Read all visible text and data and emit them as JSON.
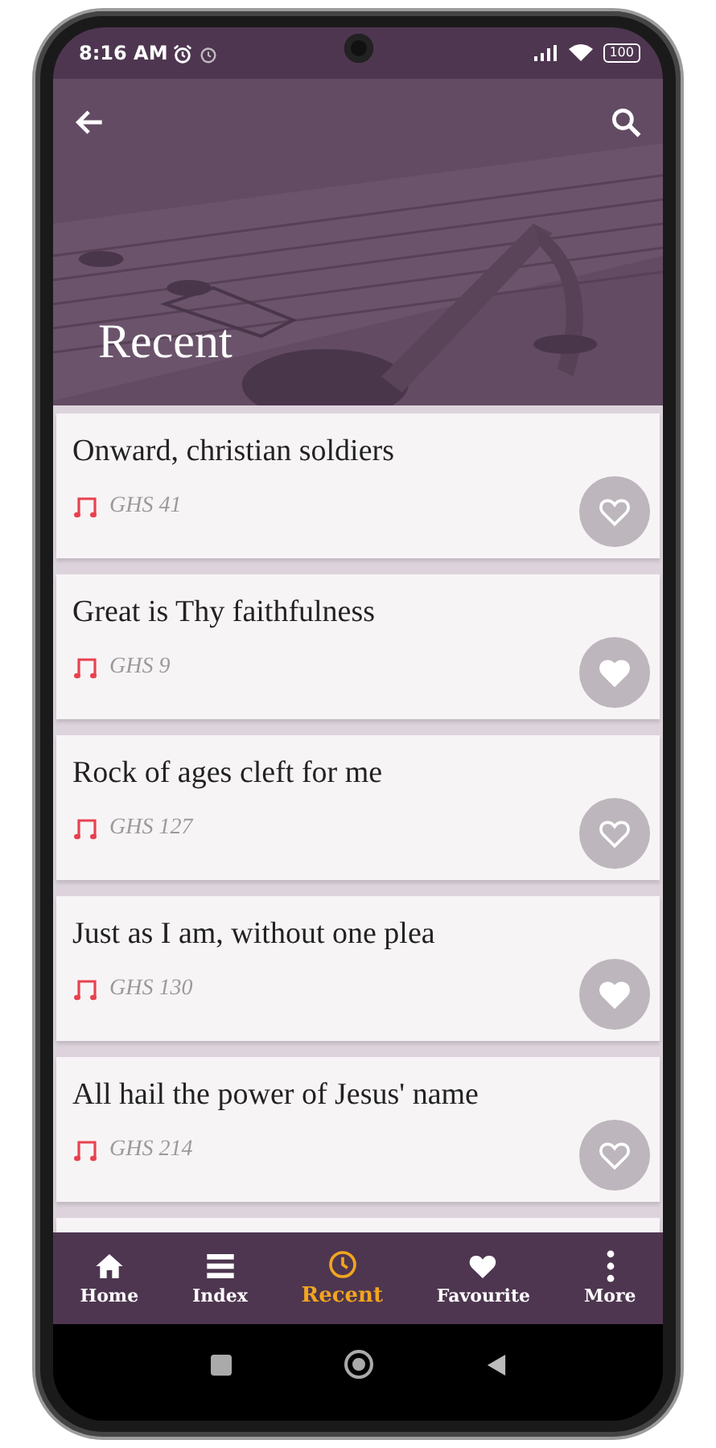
{
  "status_bar": {
    "time": "8:16 AM",
    "battery": "100"
  },
  "header": {
    "title": "Recent"
  },
  "hymns": [
    {
      "title": "Onward, christian soldiers",
      "number": "GHS 41",
      "favourite": false
    },
    {
      "title": "Great is Thy faithfulness",
      "number": "GHS 9",
      "favourite": true
    },
    {
      "title": "Rock of ages cleft for me",
      "number": "GHS 127",
      "favourite": false
    },
    {
      "title": "Just as I am, without one plea",
      "number": "GHS 130",
      "favourite": true
    },
    {
      "title": "All hail the power of Jesus' name",
      "number": "GHS 214",
      "favourite": false
    }
  ],
  "bottom_nav": [
    {
      "label": "Home",
      "selected": false
    },
    {
      "label": "Index",
      "selected": false
    },
    {
      "label": "Recent",
      "selected": true
    },
    {
      "label": "Favourite",
      "selected": false
    },
    {
      "label": "More",
      "selected": false
    }
  ]
}
